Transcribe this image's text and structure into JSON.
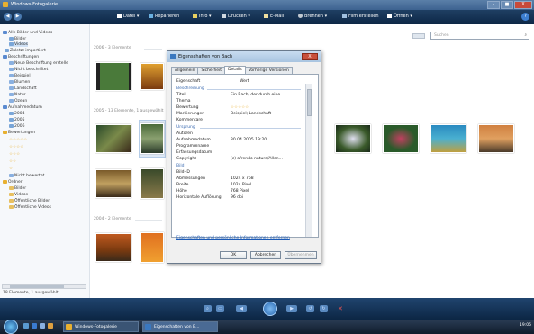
{
  "window": {
    "title": "Windows-Fotogalerie",
    "minimize": "–",
    "maximize": "■",
    "close": "X"
  },
  "toolbar": {
    "items": [
      {
        "label": "Datei ▾"
      },
      {
        "label": "Reparieren"
      },
      {
        "label": "Info ▾"
      },
      {
        "label": "Drucken ▾"
      },
      {
        "label": "E-Mail"
      },
      {
        "label": "Brennen ▾"
      },
      {
        "label": "Film erstellen"
      },
      {
        "label": "Öffnen ▾"
      }
    ],
    "help": "?"
  },
  "sidebar": {
    "items": [
      {
        "label": "Alle Bilder und Videos",
        "color": "#5a8ad0"
      },
      {
        "label": "Bilder",
        "color": "#7aa6d8"
      },
      {
        "label": "Videos",
        "color": "#7aa6d8"
      },
      {
        "label": "Zuletzt importiert",
        "color": "#7aa6d8"
      },
      {
        "label": "Beschriftungen",
        "color": "#5a8ad0"
      },
      {
        "label": "Neue Beschriftung erstelle",
        "color": "#8ab0e0"
      },
      {
        "label": "Nicht beschriftet",
        "color": "#8ab0e0"
      },
      {
        "label": "Beispiel",
        "color": "#8ab0e0"
      },
      {
        "label": "Blumen",
        "color": "#8ab0e0"
      },
      {
        "label": "Landschaft",
        "color": "#8ab0e0"
      },
      {
        "label": "Natur",
        "color": "#8ab0e0"
      },
      {
        "label": "Ozean",
        "color": "#8ab0e0"
      },
      {
        "label": "Aufnahmedatum",
        "color": "#5a8ad0"
      },
      {
        "label": "2004",
        "color": "#7aa6d8"
      },
      {
        "label": "2005",
        "color": "#7aa6d8"
      },
      {
        "label": "2006",
        "color": "#7aa6d8"
      },
      {
        "label": "Bewertungen",
        "color": "#e8b030"
      },
      {
        "label": "☆☆☆☆☆",
        "color": "#e8b030"
      },
      {
        "label": "☆☆☆☆",
        "color": "#e8b030"
      },
      {
        "label": "☆☆☆",
        "color": "#e8b030"
      },
      {
        "label": "☆☆",
        "color": "#e8b030"
      },
      {
        "label": "☆",
        "color": "#e8b030"
      },
      {
        "label": "Nicht bewertet",
        "color": "#8ab0e0"
      },
      {
        "label": "Ordner",
        "color": "#e8b030"
      },
      {
        "label": "Bilder",
        "color": "#e8c060"
      },
      {
        "label": "Videos",
        "color": "#e8c060"
      },
      {
        "label": "Öffentliche Bilder",
        "color": "#e8c060"
      },
      {
        "label": "Öffentliche Videos",
        "color": "#e8c060"
      }
    ],
    "status": "18 Elemente, 1 ausgewählt"
  },
  "main": {
    "search_placeholder": "Suchen",
    "search_icon": "search-icon",
    "groups": [
      {
        "label": "2006 - 3 Elemente"
      },
      {
        "label": "2005 - 13 Elemente, 1 ausgewählt"
      },
      {
        "label": "2004 - 2 Elemente"
      }
    ]
  },
  "dialog": {
    "title": "Eigenschaften von Bach",
    "close": "X",
    "tabs": [
      "Allgemein",
      "Sicherheit",
      "Details",
      "Vorherige Versionen"
    ],
    "active_tab": "Details",
    "col_property": "Eigenschaft",
    "col_value": "Wert",
    "sections": {
      "description": "Beschreibung",
      "origin": "Ursprung",
      "image": "Bild"
    },
    "rows_description": [
      {
        "k": "Titel",
        "v": "Ein Bach, der durch eine..."
      },
      {
        "k": "Thema",
        "v": ""
      },
      {
        "k": "Bewertung",
        "v": "☆☆☆☆☆"
      },
      {
        "k": "Markierungen",
        "v": "Beispiel; Landschaft"
      },
      {
        "k": "Kommentare",
        "v": ""
      }
    ],
    "rows_origin": [
      {
        "k": "Autoren",
        "v": ""
      },
      {
        "k": "Aufnahmedatum",
        "v": "30.04.2005 19:20"
      },
      {
        "k": "Programmname",
        "v": ""
      },
      {
        "k": "Erfassungsdatum",
        "v": ""
      },
      {
        "k": "Copyright",
        "v": "(c) afrendo nature/Allen..."
      }
    ],
    "rows_image": [
      {
        "k": "Bild-ID",
        "v": ""
      },
      {
        "k": "Abmessungen",
        "v": "1024 x 768"
      },
      {
        "k": "Breite",
        "v": "1024 Pixel"
      },
      {
        "k": "Höhe",
        "v": "768 Pixel"
      },
      {
        "k": "Horizontale Auflösung",
        "v": "96 dpi"
      }
    ],
    "link": "Eigenschaften und persönliche Informationen entfernen",
    "ok": "OK",
    "cancel": "Abbrechen",
    "apply": "Übernehmen"
  },
  "taskbar": {
    "tasks": [
      "Windows-Fotogalerie",
      "Eigenschaften von B..."
    ],
    "tray_time": "19:06"
  }
}
